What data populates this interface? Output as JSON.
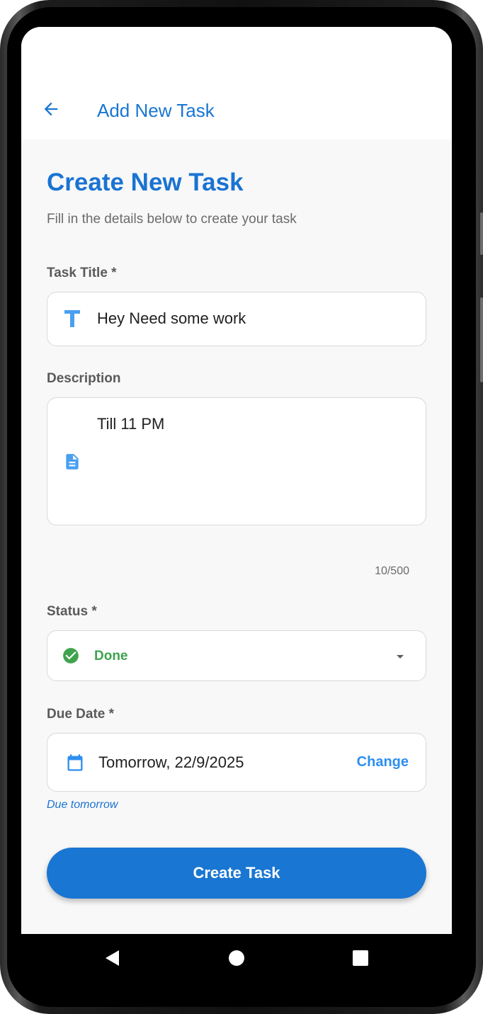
{
  "app_bar": {
    "title": "Add New Task",
    "back_icon": "arrow-back-icon"
  },
  "form": {
    "heading": "Create New Task",
    "subheading": "Fill in the details below to create your task",
    "title_field": {
      "label": "Task Title *",
      "value": "Hey Need some work",
      "icon": "text-title-icon"
    },
    "description_field": {
      "label": "Description",
      "value": "Till 11 PM",
      "icon": "document-icon",
      "counter": "10/500"
    },
    "status_field": {
      "label": "Status *",
      "value": "Done",
      "icon": "check-circle-icon",
      "dropdown_icon": "dropdown-arrow-icon"
    },
    "due_date_field": {
      "label": "Due Date *",
      "value": "Tomorrow, 22/9/2025",
      "icon": "calendar-icon",
      "change_label": "Change",
      "hint": "Due tomorrow"
    },
    "submit_label": "Create Task"
  },
  "colors": {
    "primary": "#1976d2",
    "heading": "#1a73d2",
    "status_done": "#3fa34d",
    "accent_link": "#2d8ff0",
    "background": "#f8f8f8"
  },
  "system_nav": {
    "back": "nav-back-icon",
    "home": "nav-home-icon",
    "recents": "nav-recents-icon"
  }
}
